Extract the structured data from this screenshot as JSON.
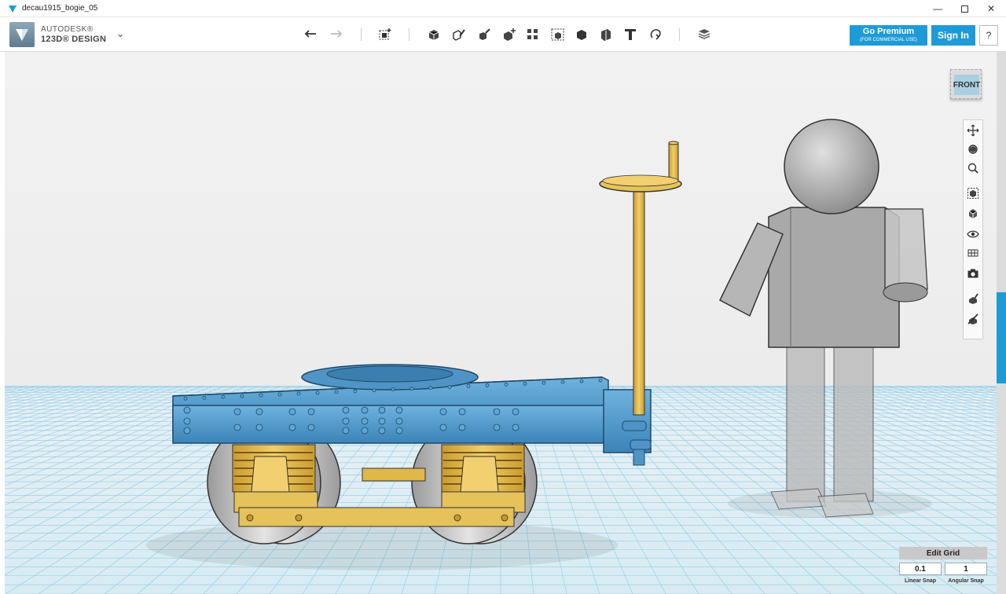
{
  "window": {
    "title": "decau1915_bogie_05",
    "minimize_icon": "minimize-icon",
    "maximize_icon": "maximize-icon",
    "close_icon": "close-icon"
  },
  "logo": {
    "line1": "AUTODESK®",
    "line2": "123D® DESIGN",
    "menu_icon": "chevron-down-icon"
  },
  "toolbar": {
    "tools": [
      "undo",
      "redo",
      "transform",
      "primitives",
      "sketch",
      "construct",
      "modify",
      "pattern",
      "group",
      "combine",
      "measure",
      "text",
      "snap",
      "material"
    ]
  },
  "account": {
    "premium_label": "Go Premium",
    "premium_sub": "(FOR COMMERCIAL USE)",
    "signin_label": "Sign In",
    "help_label": "?"
  },
  "viewcube": {
    "face_label": "FRONT"
  },
  "navbar": {
    "items": [
      "pan",
      "orbit",
      "zoom",
      "fit",
      "views",
      "visibility",
      "materials-outlines",
      "screenshot",
      "snap-grid",
      "hide-grid"
    ]
  },
  "edit_grid": {
    "title": "Edit Grid",
    "linear_value": "0.1",
    "angular_value": "1",
    "linear_label": "Linear Snap",
    "angular_label": "Angular Snap"
  },
  "colors": {
    "accent": "#1e9bd7",
    "model_blue": "#4a94c9",
    "model_gold": "#e0b84a",
    "grid_line": "#8ecae6"
  }
}
